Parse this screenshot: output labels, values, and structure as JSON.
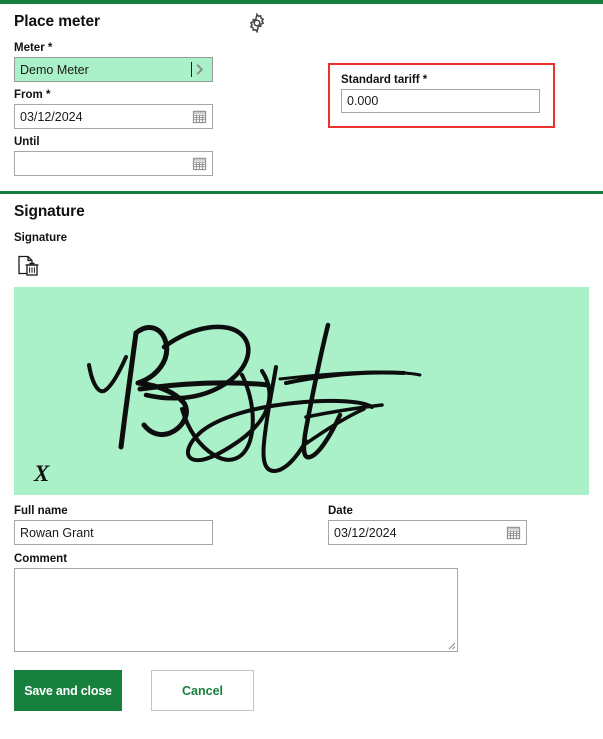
{
  "top_accent_color": "#15803d",
  "panel": {
    "title": "Place meter",
    "settings_icon": "gear-icon"
  },
  "meter": {
    "label": "Meter *",
    "value": "Demo Meter",
    "placeholder": "",
    "chevron_icon": "chevron-right-icon",
    "field_bg_color": "#aaf0c8"
  },
  "from": {
    "label": "From *",
    "value": "03/12/2024",
    "placeholder": "",
    "calendar_icon": "calendar-icon"
  },
  "until": {
    "label": "Until",
    "value": "",
    "placeholder": "",
    "calendar_icon": "calendar-icon"
  },
  "tariff": {
    "label": "Standard tariff *",
    "value": "0.000",
    "placeholder": "",
    "highlight_color": "#e8322a"
  },
  "signature_section": {
    "title": "Signature",
    "field_label": "Signature",
    "clear_icon": "document-delete-icon",
    "canvas_bg_color": "#aaf0c8",
    "signature_mark": "X"
  },
  "full_name": {
    "label": "Full name",
    "value": "Rowan Grant",
    "placeholder": ""
  },
  "date": {
    "label": "Date",
    "value": "03/12/2024",
    "placeholder": "",
    "calendar_icon": "calendar-icon"
  },
  "comment": {
    "label": "Comment",
    "value": "",
    "placeholder": ""
  },
  "actions": {
    "save_label": "Save and close",
    "cancel_label": "Cancel",
    "primary_color": "#17803c"
  }
}
